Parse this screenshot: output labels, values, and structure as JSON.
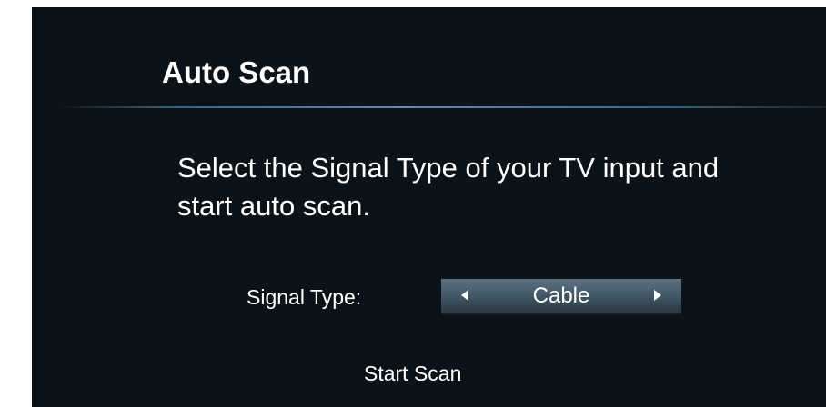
{
  "screen": {
    "title": "Auto Scan",
    "description": "Select the Signal Type of your TV input and start auto scan.",
    "signal_type": {
      "label": "Signal Type:",
      "value": "Cable",
      "left_icon": "triangle-left-icon",
      "right_icon": "triangle-right-icon"
    },
    "start_scan_label": "Start Scan"
  },
  "colors": {
    "background": "#0c1318",
    "text": "#ffffff",
    "selector_highlight": "#455a69",
    "divider": "#64a0b4"
  }
}
